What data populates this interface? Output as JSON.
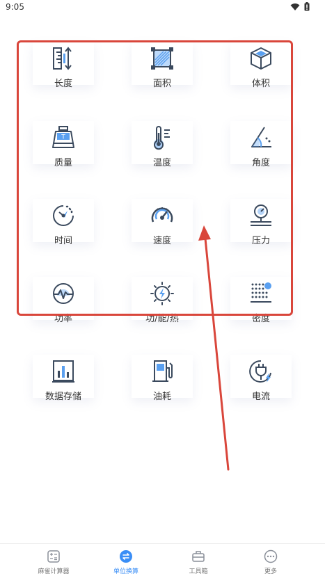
{
  "status": {
    "time": "9:05"
  },
  "units": [
    {
      "label": "长度",
      "icon": "length-icon"
    },
    {
      "label": "面积",
      "icon": "area-icon"
    },
    {
      "label": "体积",
      "icon": "volume-icon"
    },
    {
      "label": "质量",
      "icon": "mass-icon"
    },
    {
      "label": "温度",
      "icon": "temperature-icon"
    },
    {
      "label": "角度",
      "icon": "angle-icon"
    },
    {
      "label": "时间",
      "icon": "time-icon"
    },
    {
      "label": "速度",
      "icon": "speed-icon"
    },
    {
      "label": "压力",
      "icon": "pressure-icon"
    },
    {
      "label": "功率",
      "icon": "power-icon"
    },
    {
      "label": "功/能/热",
      "icon": "energy-icon"
    },
    {
      "label": "密度",
      "icon": "density-icon"
    },
    {
      "label": "数据存储",
      "icon": "data-storage-icon"
    },
    {
      "label": "油耗",
      "icon": "fuel-icon"
    },
    {
      "label": "电流",
      "icon": "current-icon"
    }
  ],
  "tabbar": [
    {
      "label": "麻雀计算器",
      "icon": "calculator-icon",
      "active": false
    },
    {
      "label": "单位换算",
      "icon": "unit-convert-icon",
      "active": true
    },
    {
      "label": "工具箱",
      "icon": "toolbox-icon",
      "active": false
    },
    {
      "label": "更多",
      "icon": "more-icon",
      "active": false
    }
  ],
  "colors": {
    "annotation": "#d9463b",
    "accent": "#3a8ef6",
    "icon_dark": "#3b4a5e",
    "icon_blue": "#5aa0f0"
  }
}
